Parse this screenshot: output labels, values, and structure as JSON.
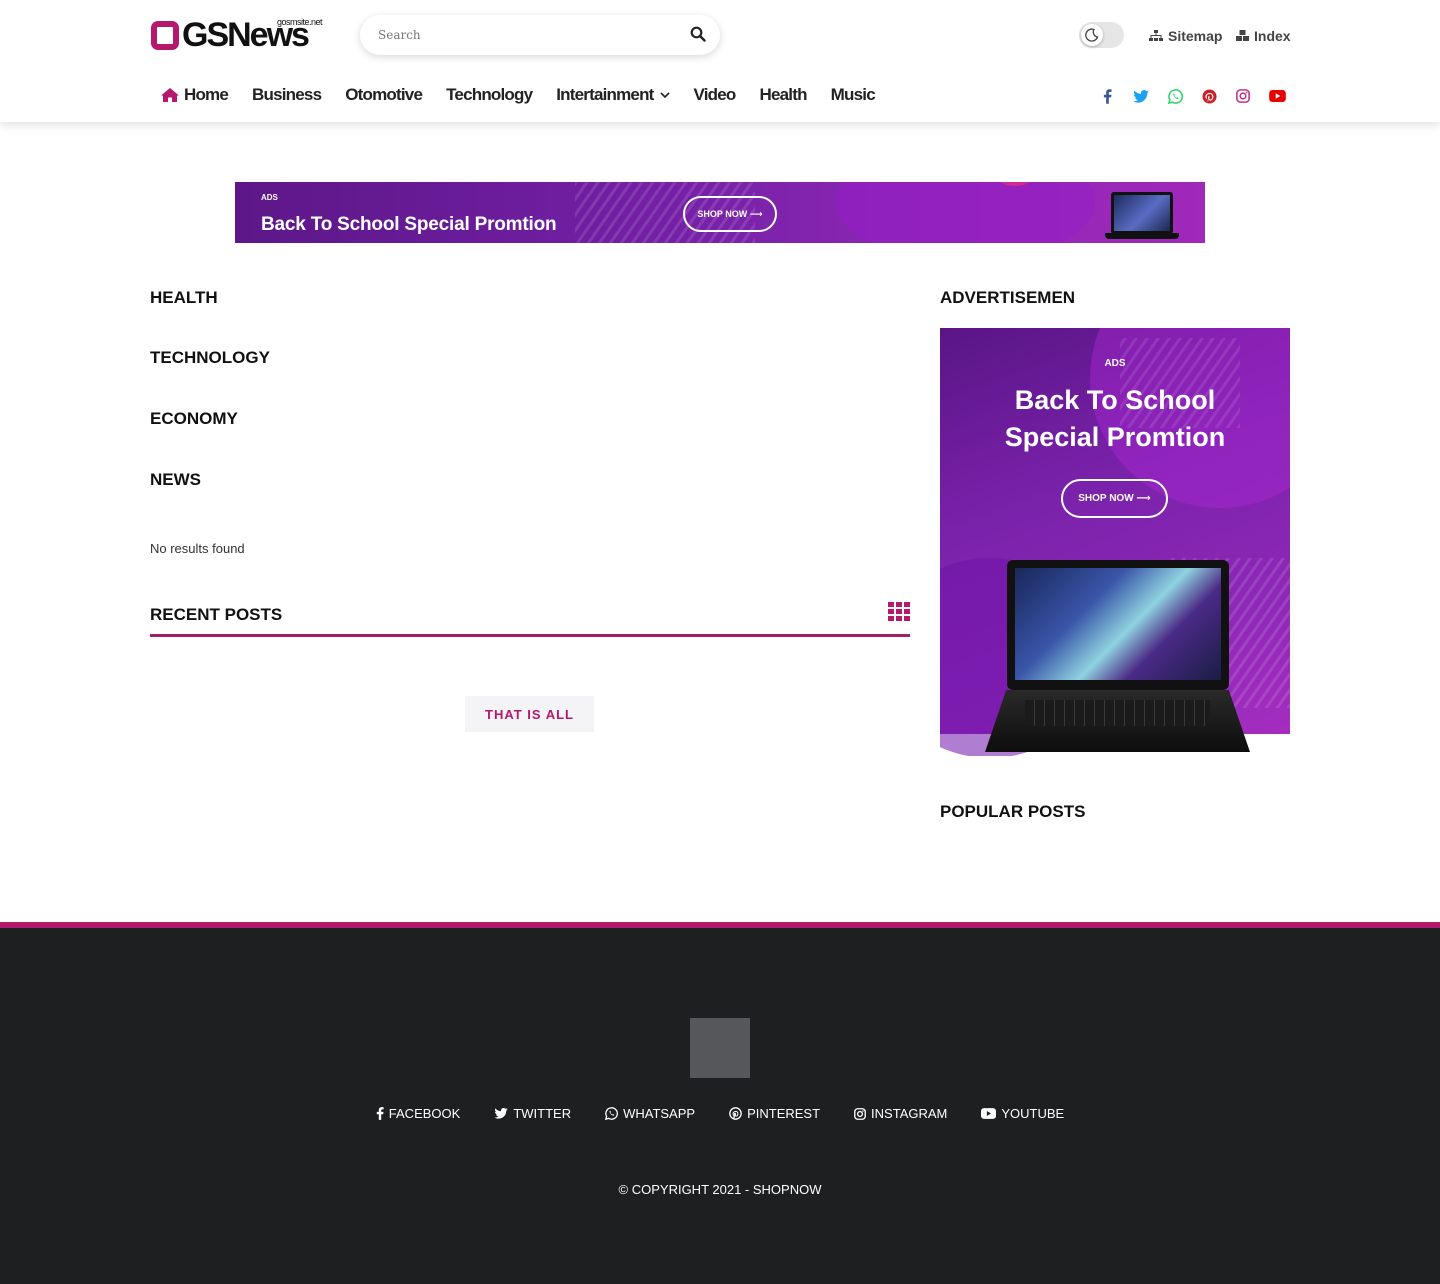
{
  "brand": {
    "logo_text": "GSNews",
    "logo_small": "gosmsite.net",
    "accent_color": "#b5196d"
  },
  "search": {
    "placeholder": "Search",
    "icon": "search-icon"
  },
  "header_links": [
    {
      "label": "Sitemap",
      "icon": "sitemap-icon"
    },
    {
      "label": "Index",
      "icon": "cubes-icon"
    }
  ],
  "theme_toggle": {
    "icon": "moon-icon"
  },
  "nav": [
    {
      "label": "Home",
      "icon": "home-icon"
    },
    {
      "label": "Business"
    },
    {
      "label": "Otomotive"
    },
    {
      "label": "Technology"
    },
    {
      "label": "Intertainment",
      "dropdown": true
    },
    {
      "label": "Video"
    },
    {
      "label": "Health"
    },
    {
      "label": "Music"
    }
  ],
  "social_top": [
    {
      "name": "facebook-icon",
      "color": "#3b5998"
    },
    {
      "name": "twitter-icon",
      "color": "#1da1f2"
    },
    {
      "name": "whatsapp-icon",
      "color": "#25d366"
    },
    {
      "name": "pinterest-icon",
      "color": "#cb2027"
    },
    {
      "name": "instagram-icon",
      "color": "#c13584"
    },
    {
      "name": "youtube-icon",
      "color": "#e60000"
    }
  ],
  "banner": {
    "ads_label": "ADS",
    "title": "Back To School Special Promtion",
    "button": "SHOP NOW ⟶"
  },
  "main": {
    "categories": [
      "HEALTH",
      "TECHNOLOGY",
      "ECONOMY",
      "NEWS"
    ],
    "no_results": "No results found",
    "recent_posts_title": "RECENT POSTS",
    "thats_all": "THAT IS ALL"
  },
  "sidebar": {
    "advert_title": "ADVERTISEMEN",
    "ad": {
      "ads_label": "ADS",
      "title_line1": "Back To School",
      "title_line2": "Special Promtion",
      "button": "SHOP NOW ⟶"
    },
    "popular_title": "POPULAR POSTS"
  },
  "footer": {
    "social": [
      {
        "label": "FACEBOOK",
        "icon": "facebook-icon"
      },
      {
        "label": "TWITTER",
        "icon": "twitter-icon"
      },
      {
        "label": "WHATSAPP",
        "icon": "whatsapp-icon"
      },
      {
        "label": "PINTEREST",
        "icon": "pinterest-icon"
      },
      {
        "label": "INSTAGRAM",
        "icon": "instagram-icon"
      },
      {
        "label": "YOUTUBE",
        "icon": "youtube-icon"
      }
    ],
    "copyright": "© COPYRIGHT 2021 - SHOPNOW"
  }
}
